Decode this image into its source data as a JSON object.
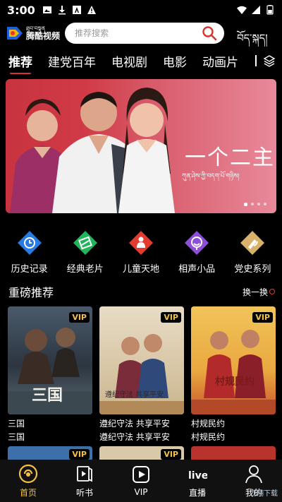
{
  "status_bar": {
    "time": "3:00"
  },
  "header": {
    "logo_small": "ཐུབ་བསྟན",
    "logo_main": "腾酷视频",
    "search_placeholder": "推荐搜索",
    "tibetan_label": "བོད་སྐད།"
  },
  "tabs": [
    {
      "label": "推荐",
      "active": true
    },
    {
      "label": "建党百年",
      "active": false
    },
    {
      "label": "电视剧",
      "active": false
    },
    {
      "label": "电影",
      "active": false
    },
    {
      "label": "动画片",
      "active": false
    }
  ],
  "banner": {
    "title": "一个二主",
    "subtitle": "ཀུན་ཤེས་ཀྱི་བདག་པོ་གཉིས།",
    "dots": 4,
    "active_dot": 0
  },
  "quick_links": [
    {
      "label": "历史记录",
      "icon": "history-clock-icon",
      "color": "#2a7be0"
    },
    {
      "label": "经典老片",
      "icon": "classic-film-icon",
      "color": "#22b45a"
    },
    {
      "label": "儿童天地",
      "icon": "kids-icon",
      "color": "#e23b2f"
    },
    {
      "label": "相声小品",
      "icon": "comedy-icon",
      "color": "#8e4fd8"
    },
    {
      "label": "党史系列",
      "icon": "party-history-icon",
      "color": "#d8b16a"
    }
  ],
  "section": {
    "title": "重磅推荐",
    "more_label": "换一换"
  },
  "cards": [
    {
      "title": "三国",
      "subtitle": "三国",
      "vip": "VIP",
      "poster_title": "三国"
    },
    {
      "title": "遵纪守法 共享平安",
      "subtitle": "遵纪守法 共享平安",
      "vip": "VIP",
      "poster_title": "遵纪守法 共享平安"
    },
    {
      "title": "村规民约",
      "subtitle": "村规民约",
      "vip": "VIP",
      "poster_title": "村规民约"
    }
  ],
  "row2_vip": [
    "VIP",
    "VIP",
    ""
  ],
  "bottom_nav": [
    {
      "label": "首页",
      "icon": "home-icon",
      "active": true
    },
    {
      "label": "听书",
      "icon": "audiobook-icon",
      "active": false
    },
    {
      "label": "VIP",
      "icon": "vip-play-icon",
      "active": false
    },
    {
      "label": "直播",
      "icon": "live-icon",
      "active": false
    },
    {
      "label": "我的",
      "icon": "profile-icon",
      "active": false
    }
  ],
  "watermark": "飞翔下载",
  "colors": {
    "accent": "#d6352b",
    "gold": "#f3c148",
    "background": "#000000"
  }
}
